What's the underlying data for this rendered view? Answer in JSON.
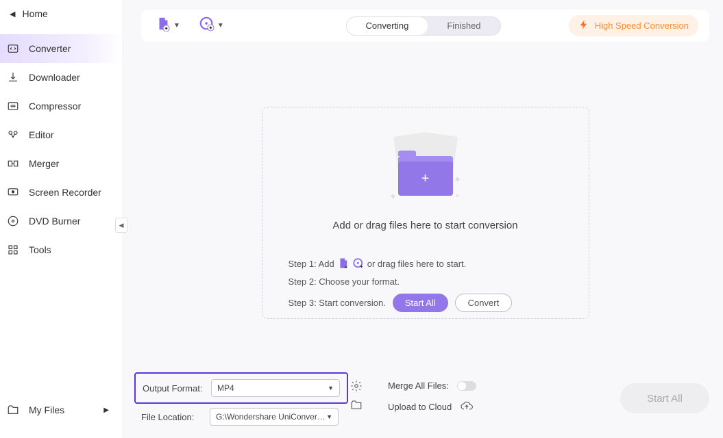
{
  "sidebar": {
    "home": "Home",
    "items": [
      {
        "label": "Converter"
      },
      {
        "label": "Downloader"
      },
      {
        "label": "Compressor"
      },
      {
        "label": "Editor"
      },
      {
        "label": "Merger"
      },
      {
        "label": "Screen Recorder"
      },
      {
        "label": "DVD Burner"
      },
      {
        "label": "Tools"
      }
    ],
    "my_files": "My Files"
  },
  "toolbar": {
    "tabs": {
      "converting": "Converting",
      "finished": "Finished"
    },
    "hsc": "High Speed Conversion"
  },
  "dropzone": {
    "caption": "Add or drag files here to start conversion",
    "step1_a": "Step 1: Add",
    "step1_b": "or drag files here to start.",
    "step2": "Step 2: Choose your format.",
    "step3": "Step 3: Start conversion.",
    "start_all": "Start All",
    "convert": "Convert"
  },
  "bottom": {
    "output_format_label": "Output Format:",
    "output_format_value": "MP4",
    "file_location_label": "File Location:",
    "file_location_value": "G:\\Wondershare UniConverter",
    "merge_label": "Merge All Files:",
    "upload_label": "Upload to Cloud",
    "start_all": "Start All"
  }
}
